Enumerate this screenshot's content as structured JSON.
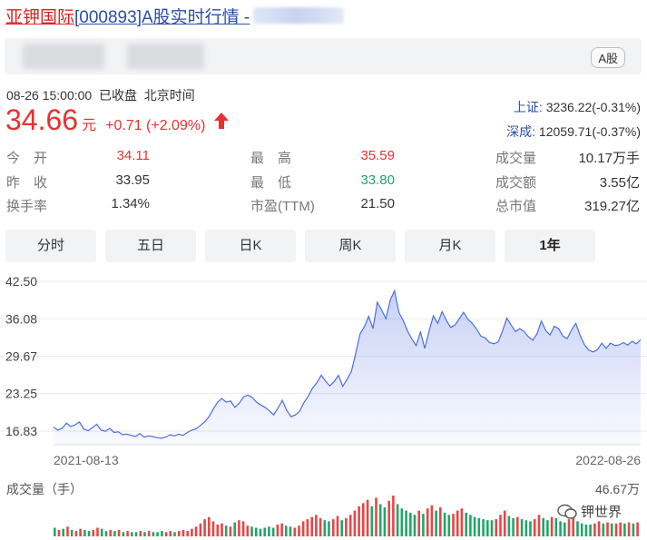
{
  "header": {
    "stock_name": "亚钾国际",
    "title_rest": "[000893]A股实时行情 -",
    "market_badge": "A股"
  },
  "quote": {
    "status": "08-26 15:00:00  已收盘  北京时间",
    "price": "34.66",
    "unit": "元",
    "change": "+0.71 (+2.09%)",
    "direction": "up"
  },
  "indices": [
    {
      "name": "上证:",
      "value": "3236.22(-0.31%)"
    },
    {
      "name": "深成:",
      "value": "12059.71(-0.37%)"
    }
  ],
  "stats": {
    "open": {
      "label": "今　开",
      "value": "34.11"
    },
    "prev": {
      "label": "昨　收",
      "value": "33.95"
    },
    "turn": {
      "label": "换手率",
      "value": "1.34%"
    },
    "high": {
      "label": "最　高",
      "value": "35.59"
    },
    "low": {
      "label": "最　低",
      "value": "33.80"
    },
    "pe": {
      "label": "市盈(TTM)",
      "value": "21.50"
    },
    "vol": {
      "label": "成交量",
      "value": "10.17万手"
    },
    "amount": {
      "label": "成交额",
      "value": "3.55亿"
    },
    "mcap": {
      "label": "总市值",
      "value": "319.27亿"
    }
  },
  "tabs": [
    {
      "label": "分时",
      "active": false
    },
    {
      "label": "五日",
      "active": false
    },
    {
      "label": "日K",
      "active": false
    },
    {
      "label": "周K",
      "active": false
    },
    {
      "label": "月K",
      "active": false
    },
    {
      "label": "1年",
      "active": true
    }
  ],
  "chart_data": {
    "type": "area",
    "y_ticks": [
      "42.50",
      "36.08",
      "29.67",
      "23.25",
      "16.83"
    ],
    "ylim": [
      16.83,
      42.5
    ],
    "x_start_label": "2021-08-13",
    "x_end_label": "2022-08-26",
    "line_color": "#4a6ee0",
    "values": [
      17.5,
      17.0,
      17.3,
      18.2,
      17.6,
      17.9,
      18.4,
      17.2,
      16.9,
      17.4,
      18.0,
      17.0,
      16.8,
      17.3,
      16.6,
      16.7,
      16.2,
      16.3,
      16.1,
      15.9,
      16.4,
      15.8,
      16.0,
      15.9,
      15.7,
      15.6,
      15.8,
      16.2,
      16.0,
      16.3,
      16.1,
      16.6,
      17.0,
      17.2,
      17.8,
      18.4,
      19.3,
      20.6,
      21.8,
      22.4,
      21.8,
      22.0,
      20.9,
      21.6,
      22.7,
      23.0,
      22.6,
      21.8,
      21.3,
      20.9,
      20.3,
      19.6,
      20.8,
      22.1,
      20.4,
      19.3,
      19.6,
      20.2,
      21.7,
      22.8,
      24.2,
      25.1,
      26.4,
      25.4,
      24.6,
      25.3,
      26.4,
      24.5,
      25.7,
      27.1,
      30.2,
      33.5,
      34.7,
      36.5,
      34.4,
      38.9,
      37.6,
      36.1,
      39.3,
      40.9,
      37.2,
      35.8,
      34.0,
      32.6,
      31.5,
      33.8,
      31.0,
      34.0,
      36.6,
      35.3,
      37.3,
      35.8,
      34.6,
      35.0,
      36.1,
      37.2,
      36.0,
      35.3,
      34.3,
      33.1,
      32.8,
      32.0,
      31.8,
      32.1,
      34.0,
      36.2,
      35.0,
      33.9,
      34.4,
      33.9,
      33.0,
      32.4,
      33.5,
      35.7,
      34.1,
      33.3,
      34.8,
      34.4,
      33.1,
      32.7,
      34.2,
      35.3,
      33.2,
      31.6,
      30.7,
      30.4,
      30.8,
      31.9,
      31.0,
      31.9,
      31.5,
      31.6,
      32.0,
      31.6,
      32.2,
      31.8,
      32.5
    ],
    "volume_label": "成交量（手）",
    "volume_max_label": "46.67万",
    "volume_max": 46.67,
    "volume_up_color": "#e84545",
    "volume_down_color": "#22a56a",
    "volumes": [
      8,
      6,
      7,
      9,
      6,
      5,
      7,
      6,
      5,
      6,
      8,
      7,
      5,
      6,
      5,
      6,
      4,
      5,
      4,
      4,
      5,
      4,
      5,
      4,
      4,
      5,
      4,
      5,
      4,
      5,
      6,
      5,
      7,
      9,
      12,
      16,
      18,
      14,
      11,
      12,
      10,
      9,
      13,
      15,
      14,
      10,
      9,
      8,
      7,
      8,
      9,
      8,
      11,
      12,
      10,
      9,
      8,
      10,
      14,
      16,
      18,
      20,
      17,
      15,
      14,
      16,
      19,
      15,
      17,
      20,
      24,
      28,
      31,
      34,
      28,
      36,
      30,
      27,
      33,
      38,
      30,
      26,
      24,
      22,
      20,
      24,
      21,
      26,
      29,
      24,
      27,
      22,
      20,
      21,
      24,
      26,
      22,
      20,
      18,
      17,
      16,
      15,
      15,
      16,
      20,
      24,
      19,
      17,
      18,
      16,
      15,
      14,
      16,
      20,
      17,
      15,
      18,
      17,
      14,
      13,
      16,
      18,
      14,
      12,
      11,
      11,
      12,
      14,
      12,
      13,
      12,
      12,
      13,
      12,
      13,
      12,
      13
    ],
    "volume_up": [
      0,
      1,
      0,
      1,
      0,
      1,
      1,
      0,
      0,
      1,
      1,
      0,
      0,
      1,
      0,
      1,
      0,
      1,
      0,
      0,
      1,
      0,
      1,
      0,
      0,
      0,
      1,
      1,
      0,
      1,
      1,
      1,
      1,
      1,
      1,
      1,
      1,
      1,
      1,
      1,
      0,
      1,
      0,
      1,
      1,
      1,
      0,
      0,
      0,
      0,
      0,
      0,
      1,
      1,
      0,
      0,
      1,
      1,
      1,
      1,
      1,
      1,
      1,
      0,
      0,
      1,
      1,
      0,
      1,
      1,
      1,
      1,
      1,
      1,
      0,
      1,
      0,
      0,
      1,
      1,
      0,
      0,
      0,
      0,
      0,
      1,
      0,
      1,
      1,
      0,
      1,
      0,
      0,
      1,
      1,
      1,
      0,
      0,
      0,
      0,
      0,
      0,
      0,
      1,
      1,
      1,
      0,
      0,
      1,
      0,
      0,
      0,
      1,
      1,
      0,
      0,
      1,
      0,
      0,
      0,
      1,
      1,
      0,
      0,
      0,
      0,
      1,
      1,
      0,
      1,
      0,
      1,
      1,
      0,
      1,
      0,
      1
    ],
    "watermark_text": "钾世界"
  }
}
